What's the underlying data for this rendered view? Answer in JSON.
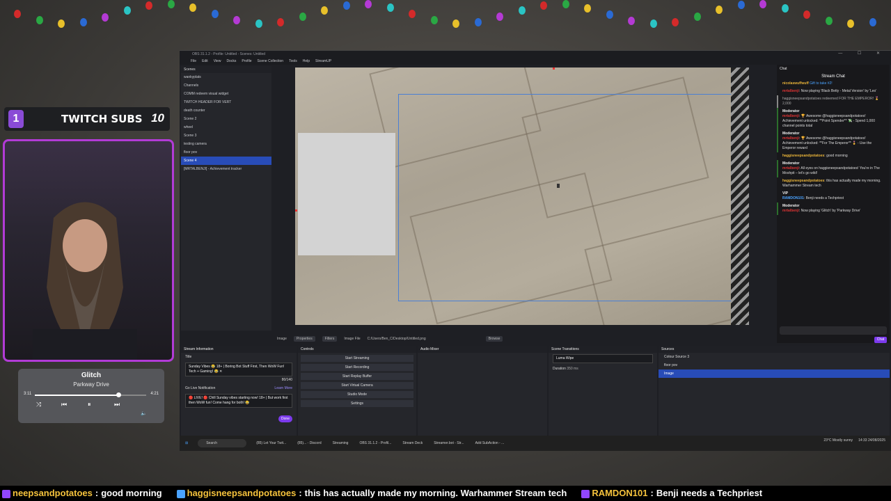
{
  "window": {
    "title": "OBS 31.1.2 - Profile: Untitled - Scenes: Untitled",
    "controls": "— ☐ ✕"
  },
  "menu": [
    "File",
    "Edit",
    "View",
    "Docks",
    "Profile",
    "Scene Collection",
    "Tools",
    "Help",
    "StreamUP"
  ],
  "scenes": {
    "header": "Scenes",
    "items": [
      "wankyplats",
      "Channels",
      "COMM redeem visual widget",
      "TWITCH HEADER FOR VERT",
      "death counter",
      "Scene 2",
      "wheel",
      "Scene 3",
      "testing camera",
      "floor pov",
      "Scene 4",
      "[MRTALBENJI] - Achievement tracker"
    ],
    "selected_index": 10
  },
  "preview_toolbar": {
    "source_label": "Image",
    "properties": "Properties",
    "filters": "Filters",
    "image_file_label": "Image File",
    "image_path": "C:/Users/Ben_C/Desktop/Untitled.png",
    "browse": "Browse"
  },
  "stream_info": {
    "header": "Stream Information",
    "title_label": "Title",
    "title_value": "Sunday Vibes 😂 18+ | Boring Bot Stuff First, Then WoW Fun! Tech + Gaming! 😂 ✕",
    "title_count": "80/140",
    "notif_label": "Go Live Notification",
    "learn_more": "Learn More",
    "notif_value": "🔴 LIVE! 🔴 Chill Sunday vibes starting now! 18+ | But work first then WoW fun! Come hang for both! 😂",
    "done": "Done"
  },
  "controls": {
    "header": "Controls",
    "buttons": [
      "Start Streaming",
      "Start Recording",
      "Start Replay Buffer",
      "Start Virtual Camera",
      "Studio Mode",
      "Settings"
    ]
  },
  "audio_mixer": {
    "header": "Audio Mixer"
  },
  "transitions": {
    "header": "Scene Transitions",
    "current": "Luma Wipe",
    "duration_label": "Duration",
    "duration_value": "350 ms"
  },
  "sources": {
    "header": "Sources",
    "items": [
      "Colour Source 3",
      "floor pov",
      "Image"
    ],
    "selected_index": 2
  },
  "chat": {
    "dock_label": "Chat",
    "title": "Stream Chat",
    "top_user": "nicolaswuffwuff",
    "top_gift": "Gift to take #2!",
    "messages": [
      {
        "kind": "normal",
        "user": "mrtalbenji",
        "text": ": Now playing 'Black Betty - Metal Version' by 'Leo'"
      },
      {
        "kind": "redeem",
        "user": "",
        "text": "haggisneepsandpotatoes redeemed FOR THE EMPEROR! 🎖️ 2,000"
      },
      {
        "kind": "mod",
        "tag": "Moderator",
        "user": "mrtalbenji",
        "text": ": 🏆 Awesome @haggisneepsandpotatoes! Achievement unlocked: **Point Spender** 💸 - Spend 1,000 channel points total"
      },
      {
        "kind": "mod",
        "tag": "Moderator",
        "user": "mrtalbenji",
        "text": ": 🏆 Awesome @haggisneepsandpotatoes! Achievement unlocked: **For The Emperor** 🎖️ - Use the Emperor reward"
      },
      {
        "kind": "normal",
        "user": "haggisneepsandpotatoes",
        "text": ": good morning"
      },
      {
        "kind": "mod",
        "tag": "Moderator",
        "user": "mrtalbenji",
        "text": ": All eyes on haggisneepsandpotatoes! You're in The Moshpit – let's go wild!"
      },
      {
        "kind": "normal",
        "user": "haggisneepsandpotatoes",
        "text": ": this has actually made my morning. Warhammer Stream tech"
      },
      {
        "kind": "vip",
        "tag": "VIP",
        "user": "RAMDON101",
        "text": ": Benji needs a Techpriest"
      },
      {
        "kind": "mod",
        "tag": "Moderator",
        "user": "mrtalbenji",
        "text": ": Now playing 'Glitch' by 'Parkway Drive'"
      }
    ],
    "send": "Chat"
  },
  "taskbar": {
    "search": "Search",
    "apps": [
      "(85) Let Your Twit...",
      "(85)... - Discord",
      "Streaming",
      "OBS 31.1.2 - Profil...",
      "Stream Deck",
      "Streamer.bot - Str...",
      "Add SubAction - ..."
    ],
    "weather": "23°C Mostly sunny",
    "time": "14:33",
    "date": "24/08/2025"
  },
  "subs": {
    "current": "1",
    "label": "TWITCH SUBS",
    "goal": "10"
  },
  "now_playing": {
    "title": "Glitch",
    "artist": "Parkway Drive",
    "elapsed": "3:11",
    "total": "4:21",
    "progress": 0.75
  },
  "ticker": [
    {
      "user": "neepsandpotatoes",
      "text": "good morning"
    },
    {
      "user": "haggisneepsandpotatoes",
      "text": "this has actually made my morning. Warhammer Stream tech"
    },
    {
      "user": "RAMDON101",
      "text": "Benji needs a Techpriest"
    }
  ],
  "colors": {
    "accent": "#7c3aed",
    "selection": "#284cb8",
    "cam_border": "#b23bd6",
    "ticker_user": "#f5c23c"
  }
}
